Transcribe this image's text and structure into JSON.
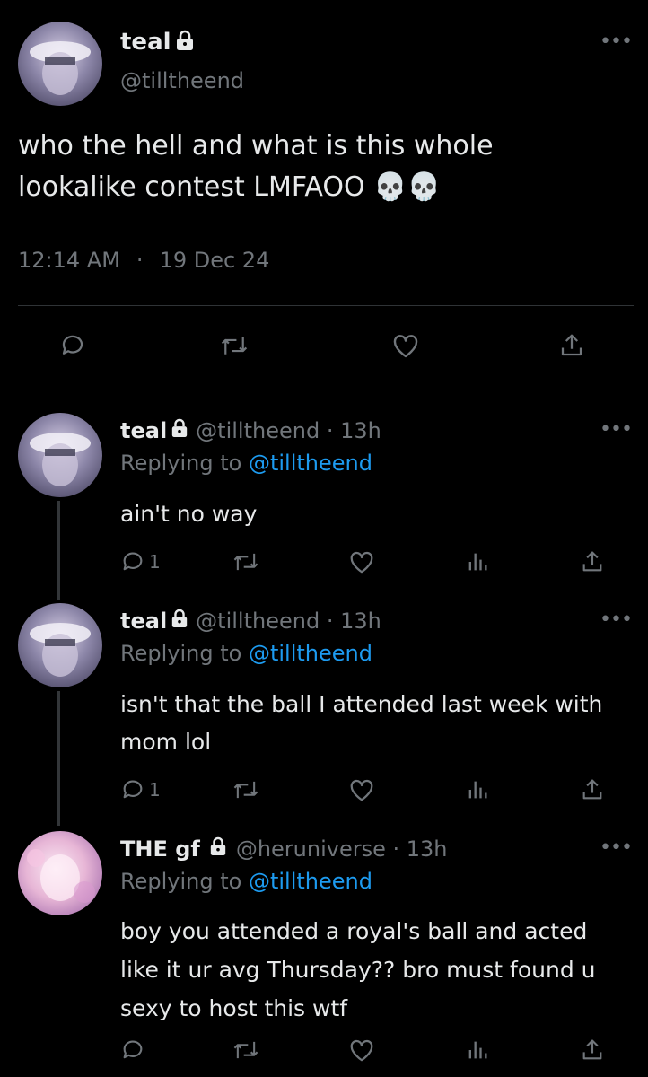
{
  "main_tweet": {
    "display_name": "teal",
    "handle": "@tilltheend",
    "text": "who the hell and what is this whole lookalike contest LMFAOO 💀💀",
    "time": "12:14 AM",
    "separator": "·",
    "date": "19 Dec 24"
  },
  "replies": [
    {
      "display_name": "teal",
      "meta": "@tilltheend · 13h",
      "replying_label": "Replying to",
      "replying_handle": "@tilltheend",
      "text": "ain't no way",
      "reply_count": "1"
    },
    {
      "display_name": "teal",
      "meta": "@tilltheend · 13h",
      "replying_label": "Replying to",
      "replying_handle": "@tilltheend",
      "text": "isn't that the ball I attended last week with mom lol",
      "reply_count": "1"
    },
    {
      "display_name": "THE gf",
      "meta": "@heruniverse · 13h",
      "replying_label": "Replying to",
      "replying_handle": "@tilltheend",
      "text": "boy you attended a royal's ball and acted like it ur avg Thursday?? bro must found u sexy to host this wtf",
      "reply_count": ""
    }
  ],
  "icons": {
    "more": "more-icon",
    "lock": "lock-icon",
    "reply": "reply-icon",
    "retweet": "retweet-icon",
    "like": "heart-icon",
    "views": "views-icon",
    "share": "share-icon"
  },
  "colors": {
    "background": "#000000",
    "text": "#e7e9ea",
    "secondary": "#71767b",
    "link": "#1d9bf0",
    "divider": "#2f3336"
  }
}
